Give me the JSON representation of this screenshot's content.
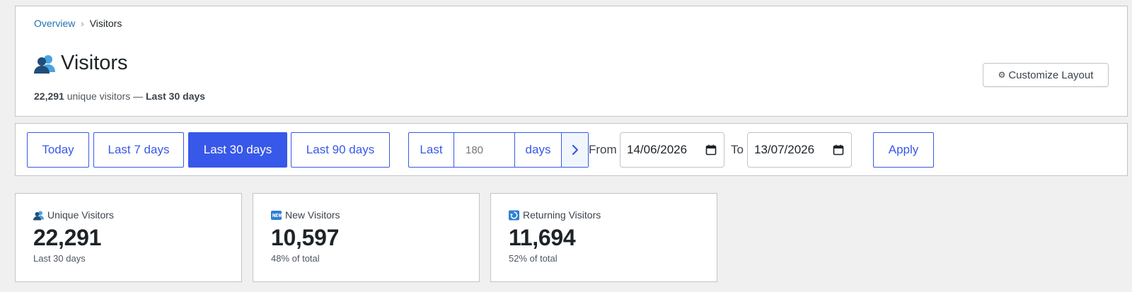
{
  "breadcrumb": {
    "parent": "Overview",
    "separator": "›",
    "current": "Visitors"
  },
  "header": {
    "title": "Visitors",
    "title_icon": "visitors-icon",
    "unique_count": "22,291",
    "subtitle_middle": "unique visitors —",
    "period": "Last 30 days",
    "customize_icon": "⚙",
    "customize_label": "Customize Layout"
  },
  "filters": {
    "ranges": [
      {
        "label": "Today",
        "active": false
      },
      {
        "label": "Last 7 days",
        "active": false
      },
      {
        "label": "Last 30 days",
        "active": true
      },
      {
        "label": "Last 90 days",
        "active": false
      }
    ],
    "custom": {
      "prefix": "Last",
      "placeholder": "180",
      "unit": "days",
      "go_icon": "chevron-right-icon"
    },
    "from_label": "From",
    "from_value": "14/06/2026",
    "to_label": "To",
    "to_value": "13/07/2026",
    "apply_label": "Apply"
  },
  "stats": [
    {
      "icon": "visitors-icon",
      "label": "Unique Visitors",
      "value": "22,291",
      "sub": "Last 30 days"
    },
    {
      "icon": "new-badge-icon",
      "label": "New Visitors",
      "value": "10,597",
      "sub": "48% of total"
    },
    {
      "icon": "returning-icon",
      "label": "Returning Visitors",
      "value": "11,694",
      "sub": "52% of total"
    }
  ],
  "colors": {
    "accent": "#3858e9",
    "link": "#2271b1",
    "border": "#c3c4c7",
    "background": "#f0f0f1"
  }
}
